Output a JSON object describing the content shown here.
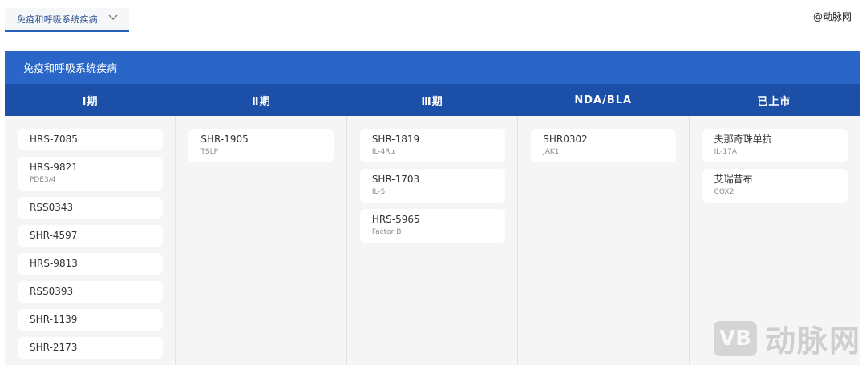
{
  "filter": {
    "selected": "免疫和呼吸系统疾病"
  },
  "corner_mark": "@动脉网",
  "banner": {
    "title": "免疫和呼吸系统疾病"
  },
  "phases": [
    "Ⅰ期",
    "Ⅱ期",
    "Ⅲ期",
    "NDA/BLA",
    "已上市"
  ],
  "columns": [
    {
      "cards": [
        {
          "name": "HRS-7085",
          "target": ""
        },
        {
          "name": "HRS-9821",
          "target": "PDE3/4"
        },
        {
          "name": "RSS0343",
          "target": ""
        },
        {
          "name": "SHR-4597",
          "target": ""
        },
        {
          "name": "HRS-9813",
          "target": ""
        },
        {
          "name": "RSS0393",
          "target": ""
        },
        {
          "name": "SHR-1139",
          "target": ""
        },
        {
          "name": "SHR-2173",
          "target": ""
        }
      ]
    },
    {
      "cards": [
        {
          "name": "SHR-1905",
          "target": "TSLP"
        }
      ]
    },
    {
      "cards": [
        {
          "name": "SHR-1819",
          "target": "IL-4Rα"
        },
        {
          "name": "SHR-1703",
          "target": "IL-5"
        },
        {
          "name": "HRS-5965",
          "target": "Factor B"
        }
      ]
    },
    {
      "cards": [
        {
          "name": "SHR0302",
          "target": "JAK1"
        }
      ]
    },
    {
      "cards": [
        {
          "name": "夫那奇珠单抗",
          "target": "IL-17A"
        },
        {
          "name": "艾瑞昔布",
          "target": "COX2"
        }
      ]
    }
  ],
  "watermark": {
    "logo": "VB",
    "text": "动脉网"
  },
  "colors": {
    "banner": "#2966c8",
    "phase_header": "#1b4fa8",
    "accent": "#2a5fb5"
  }
}
